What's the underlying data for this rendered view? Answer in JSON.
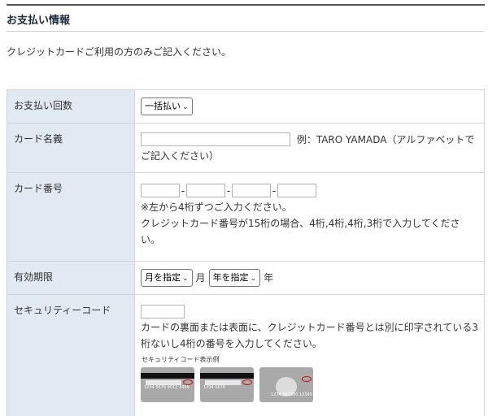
{
  "section": {
    "title": "お支払い情報"
  },
  "intro": "クレジットカードご利用の方のみご記入ください。",
  "rows": {
    "payment_count": {
      "label": "お支払い回数",
      "select_value": "一括払い"
    },
    "card_name": {
      "label": "カード名義",
      "example": "例：TARO YAMADA（アルファベットでご記入ください）"
    },
    "card_number": {
      "label": "カード番号",
      "separator": "-",
      "note1": "※左から4桁ずつご入力ください。",
      "note2": "クレジットカード番号が15桁の場合、4桁,4桁,4桁,3桁で入力してください。"
    },
    "expiry": {
      "label": "有効期限",
      "month_select": "月を指定",
      "month_unit": "月",
      "year_select": "年を指定",
      "year_unit": "年"
    },
    "security_code": {
      "label": "セキュリティーコード",
      "note": "カードの裏面または表面に、クレジットカード番号とは別に印字されている3桁ないし4桁の番号を入力してください。",
      "sample_caption": "セキュリティコード表示例",
      "card_samples": [
        {
          "number": "1234 5678 9012 3456",
          "code": "123"
        },
        {
          "number": "1234 5678",
          "code": "123"
        },
        {
          "number": "1234 567890 12345",
          "code": "1234"
        }
      ]
    }
  }
}
